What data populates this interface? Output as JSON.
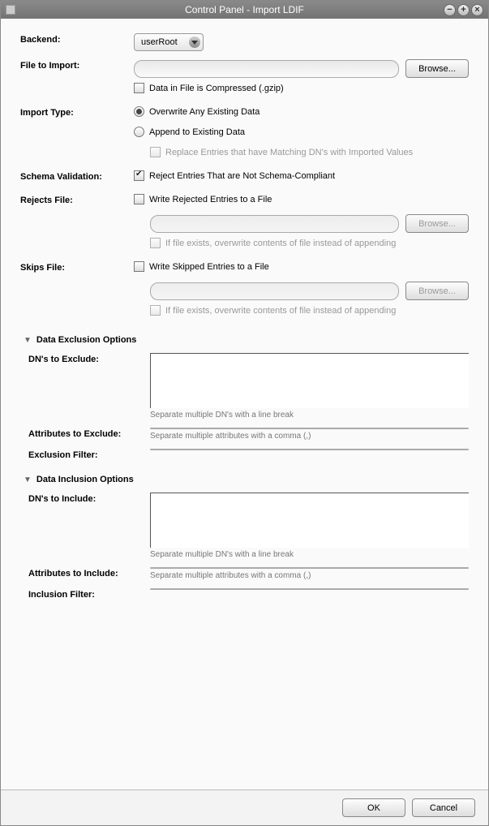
{
  "window": {
    "title": "Control Panel - Import LDIF"
  },
  "labels": {
    "backend": "Backend:",
    "fileToImport": "File to Import:",
    "importType": "Import Type:",
    "schemaValidation": "Schema Validation:",
    "rejectsFile": "Rejects File:",
    "skipsFile": "Skips File:",
    "dataExclusion": "Data Exclusion Options",
    "dataInclusion": "Data Inclusion Options",
    "dnsExclude": "DN's to Exclude:",
    "attrsExclude": "Attributes to Exclude:",
    "exclusionFilter": "Exclusion Filter:",
    "dnsInclude": "DN's to Include:",
    "attrsInclude": "Attributes to Include:",
    "inclusionFilter": "Inclusion Filter:"
  },
  "backend": {
    "selected": "userRoot"
  },
  "buttons": {
    "browse": "Browse...",
    "ok": "OK",
    "cancel": "Cancel"
  },
  "checks": {
    "compressed": "Data in File is Compressed (.gzip)",
    "rejectSchema": "Reject Entries That are Not Schema-Compliant",
    "writeRejected": "Write Rejected Entries to a File",
    "writeSkipped": "Write Skipped Entries to a File",
    "overwriteExisting": "If file exists, overwrite contents of file instead of appending",
    "replaceDN": "Replace Entries that have Matching DN's with Imported Values"
  },
  "radios": {
    "overwrite": "Overwrite Any Existing Data",
    "append": "Append to Existing Data"
  },
  "hints": {
    "dnBreak": "Separate multiple DN's with a line break",
    "attrComma": "Separate multiple attributes with a comma (,)"
  },
  "values": {
    "fileToImport": "",
    "rejectsFile": "",
    "skipsFile": "",
    "dnsExclude": "",
    "attrsExclude": "",
    "exclusionFilter": "",
    "dnsInclude": "",
    "attrsInclude": "",
    "inclusionFilter": ""
  }
}
